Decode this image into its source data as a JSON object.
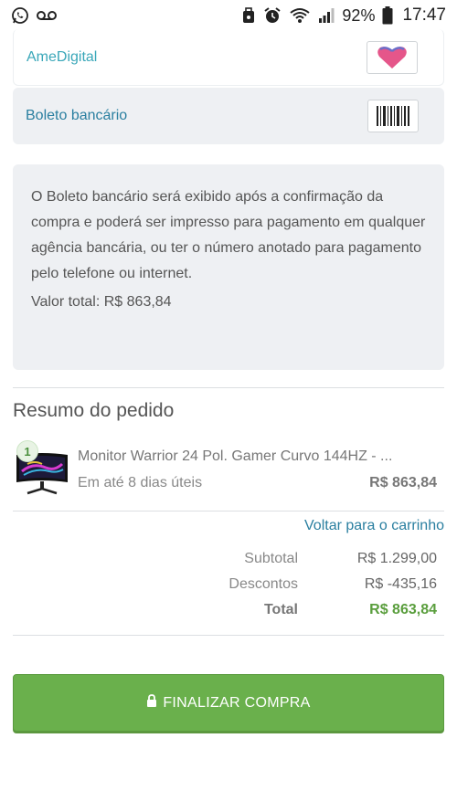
{
  "statusbar": {
    "left_icons": [
      "whatsapp-icon",
      "voicemail-icon"
    ],
    "right_icons": [
      "lock-alarm-icon",
      "alarm-icon",
      "wifi-icon",
      "signal-icon",
      "battery-icon"
    ],
    "battery_pct": "92%",
    "time": "17:47"
  },
  "payment": {
    "ame_label": "AmeDigital",
    "ame_icon": "heart-icon",
    "ame_color": "#e5568a",
    "boleto_label": "Boleto bancário",
    "boleto_icon": "barcode-icon"
  },
  "boleto_info": {
    "text": "O Boleto bancário será exibido após a confirmação da compra e poderá ser impresso para pagamento em qualquer agência bancária, ou ter o número anotado para pagamento pelo telefone ou internet.",
    "total_line": "Valor total: R$ 863,84"
  },
  "resumo": {
    "title": "Resumo do pedido",
    "item": {
      "qty": "1",
      "name": "Monitor Warrior 24 Pol. Gamer Curvo 144HZ - ...",
      "delivery": "Em até 8 dias úteis",
      "price": "R$ 863,84",
      "thumb_icon": "monitor-icon"
    },
    "voltar_label": "Voltar para o carrinho",
    "subtotal_label": "Subtotal",
    "subtotal_value": "R$ 1.299,00",
    "descontos_label": "Descontos",
    "descontos_value": "R$ -435,16",
    "total_label": "Total",
    "total_value": "R$ 863,84"
  },
  "finalizar": {
    "label": "FINALIZAR COMPRA",
    "icon": "lock-icon",
    "color": "#6ab04c"
  }
}
